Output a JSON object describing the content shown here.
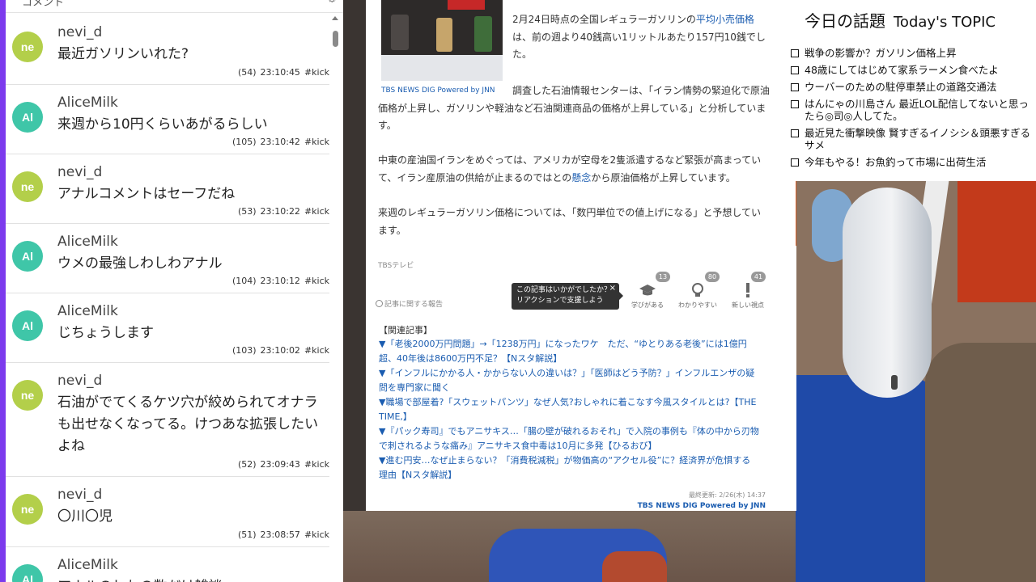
{
  "chat": {
    "header_left": "コメント",
    "header_right": "⚙",
    "messages": [
      {
        "avatar": "ne",
        "avatar_color": "#b3cf4a",
        "user": "nevi_d",
        "text": "最近ガソリンいれた?",
        "count": "(54)",
        "time": "23:10:45",
        "tag": "#kick"
      },
      {
        "avatar": "Al",
        "avatar_color": "#3fc6a8",
        "user": "AliceMilk",
        "text": "来週から10円くらいあがるらしい",
        "count": "(105)",
        "time": "23:10:42",
        "tag": "#kick"
      },
      {
        "avatar": "ne",
        "avatar_color": "#b3cf4a",
        "user": "nevi_d",
        "text": "アナルコメントはセーフだね",
        "count": "(53)",
        "time": "23:10:22",
        "tag": "#kick"
      },
      {
        "avatar": "Al",
        "avatar_color": "#3fc6a8",
        "user": "AliceMilk",
        "text": "ウメの最強しわしわアナル",
        "count": "(104)",
        "time": "23:10:12",
        "tag": "#kick"
      },
      {
        "avatar": "Al",
        "avatar_color": "#3fc6a8",
        "user": "AliceMilk",
        "text": "じちょうします",
        "count": "(103)",
        "time": "23:10:02",
        "tag": "#kick"
      },
      {
        "avatar": "ne",
        "avatar_color": "#b3cf4a",
        "user": "nevi_d",
        "text": "石油がでてくるケツ穴が絞められてオナラも出せなくなってる。けつあな拡張したいよね",
        "count": "(52)",
        "time": "23:09:43",
        "tag": "#kick"
      },
      {
        "avatar": "ne",
        "avatar_color": "#b3cf4a",
        "user": "nevi_d",
        "text": "〇川〇児",
        "count": "(51)",
        "time": "23:08:57",
        "tag": "#kick"
      },
      {
        "avatar": "Al",
        "avatar_color": "#3fc6a8",
        "user": "AliceMilk",
        "text": "アナルのしわの数だけ雑談",
        "count": "",
        "time": "",
        "tag": ""
      }
    ]
  },
  "article": {
    "image_caption": "TBS NEWS DIG Powered by JNN",
    "p1_a": "2月24日時点の全国レギュラーガソリンの",
    "p1_link": "平均小売価格",
    "p1_b": "は、前の週より40銭高い1リットルあたり157円10銭でした。",
    "p2": "調査した石油情報センターは、「イラン情勢の緊迫化で原油価格が上昇し、ガソリンや軽油など石油関連商品の価格が上昇している」と分析しています。",
    "p3_a": "中東の産油国イランをめぐっては、アメリカが空母を2隻派遣するなど緊張が高まっていて、イラン産原油の供給が止まるのではとの",
    "p3_link": "懸念",
    "p3_b": "から原油価格が上昇しています。",
    "p4": "来週のレギュラーガソリン価格については、「数円単位での値上げになる」と予想しています。",
    "source": "TBSテレビ",
    "report_link": "記事に関する報告",
    "tooltip_line1": "この記事はいかがでしたか？",
    "tooltip_line2": "リアクションで支援しよう",
    "tooltip_close": "×",
    "reactions": [
      {
        "label": "学びがある",
        "count": "13",
        "icon": "graduation-cap-icon"
      },
      {
        "label": "わかりやすい",
        "count": "80",
        "icon": "lightbulb-icon"
      },
      {
        "label": "新しい視点",
        "count": "41",
        "icon": "exclamation-icon"
      }
    ],
    "related_heading": "【関連記事】",
    "related": [
      "▼「老後2000万円問題」→「1238万円」になったワケ　ただ、“ゆとりある老後”には1億円超、40年後は8600万円不足？【Nスタ解説】",
      "▼「インフルにかかる人・かからない人の違いは？」「医師はどう予防？」インフルエンザの疑問を専門家に聞く",
      "▼職場で部屋着?「スウェットパンツ」なぜ人気?おしゃれに着こなす今風スタイルとは?【THE TIME,】",
      "▼『パック寿司』でもアニサキス…「腸の壁が破れるおそれ」で入院の事例も『体の中から刃物で刺されるような痛み』アニサキス食中毒は10月に多発【ひるおび】",
      "▼進む円安…なぜ止まらない？「消費税減税」が物価高の“アクセル役”に？経済界が危惧する理由【Nスタ解説】"
    ],
    "updated": "最終更新: 2/26(木) 14:37",
    "footer_brand": "TBS NEWS DIG Powered by JNN"
  },
  "topic": {
    "title_ja": "今日の話題",
    "title_en": "Today's TOPIC",
    "items": [
      "戦争の影響か？ガソリン価格上昇",
      "48歳にしてはじめて家系ラーメン食べたよ",
      "ウーバーのための駐停車禁止の道路交通法",
      "はんにゃの川島さん 最近LOL配信してないと思ったら◎司◎人してた。",
      "最近見た衝撃映像 賢すぎるイノシシ＆頭悪すぎるサメ",
      "今年もやる！お魚釣って市場に出荷生活"
    ]
  },
  "colors": {
    "chat_accent": "#7c3aed",
    "link_blue": "#1a5cb0"
  }
}
